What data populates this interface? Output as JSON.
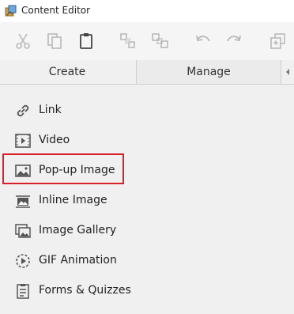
{
  "window": {
    "title": "Content Editor",
    "icon": "content-editor-app-icon"
  },
  "toolbar": {
    "buttons": [
      {
        "name": "cut",
        "icon": "scissors-icon",
        "enabled": false
      },
      {
        "name": "copy",
        "icon": "copy-icon",
        "enabled": false
      },
      {
        "name": "paste",
        "icon": "clipboard-icon",
        "enabled": true
      },
      {
        "name": "group",
        "icon": "group-icon",
        "enabled": false
      },
      {
        "name": "ungroup",
        "icon": "ungroup-icon",
        "enabled": false
      },
      {
        "name": "undo",
        "icon": "undo-icon",
        "enabled": false
      },
      {
        "name": "redo",
        "icon": "redo-icon",
        "enabled": false
      },
      {
        "name": "duplicate",
        "icon": "duplicate-icon",
        "enabled": false
      }
    ]
  },
  "tabs": [
    {
      "label": "Create",
      "active": true
    },
    {
      "label": "Manage",
      "active": false
    }
  ],
  "items": [
    {
      "label": "Link",
      "icon": "link-icon"
    },
    {
      "label": "Video",
      "icon": "video-icon"
    },
    {
      "label": "Pop-up Image",
      "icon": "image-icon",
      "highlighted": true
    },
    {
      "label": "Inline Image",
      "icon": "inline-image-icon"
    },
    {
      "label": "Image Gallery",
      "icon": "image-gallery-icon"
    },
    {
      "label": "GIF Animation",
      "icon": "gif-animation-icon"
    },
    {
      "label": "Forms & Quizzes",
      "icon": "forms-quizzes-icon"
    }
  ],
  "colors": {
    "highlight": "#d9202a",
    "disabled_icon": "#b9b9b9",
    "enabled_icon": "#555555"
  }
}
